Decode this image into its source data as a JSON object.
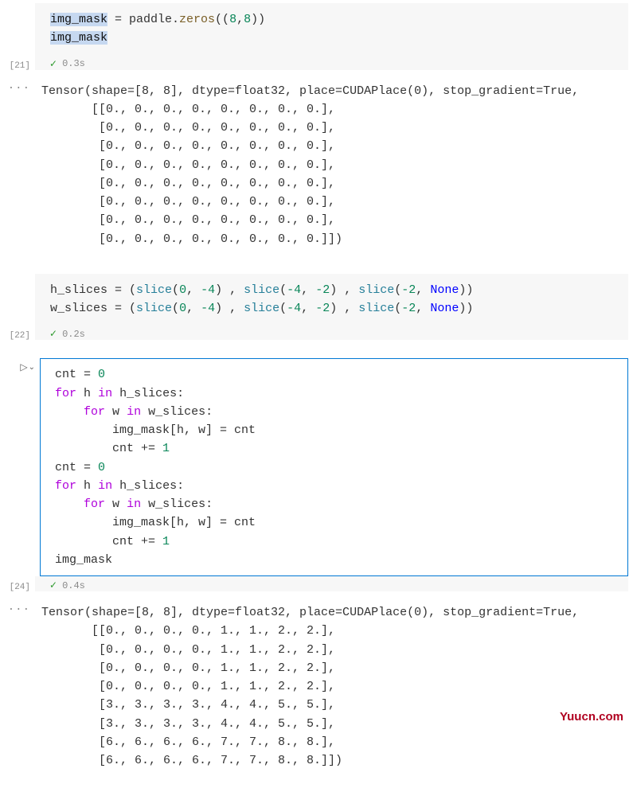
{
  "watermark": "Yuucn.com",
  "cells": {
    "c21": {
      "number": "[21]",
      "time": "0.3s",
      "code": {
        "l1_sel": "img_mask",
        "l1_rest": " = paddle.",
        "l1_fn": "zeros",
        "l1_args": "((",
        "l1_n1": "8",
        "l1_comma": ",",
        "l1_n2": "8",
        "l1_end": "))",
        "l2_sel": "img_mask"
      }
    },
    "out21": {
      "dots": "···",
      "text": "Tensor(shape=[8, 8], dtype=float32, place=CUDAPlace(0), stop_gradient=True,\n       [[0., 0., 0., 0., 0., 0., 0., 0.],\n        [0., 0., 0., 0., 0., 0., 0., 0.],\n        [0., 0., 0., 0., 0., 0., 0., 0.],\n        [0., 0., 0., 0., 0., 0., 0., 0.],\n        [0., 0., 0., 0., 0., 0., 0., 0.],\n        [0., 0., 0., 0., 0., 0., 0., 0.],\n        [0., 0., 0., 0., 0., 0., 0., 0.],\n        [0., 0., 0., 0., 0., 0., 0., 0.]])"
    },
    "c22": {
      "number": "[22]",
      "time": "0.2s",
      "code": {
        "seg_h": "h_slices = (",
        "seg_w": "w_slices = (",
        "slice_fn": "slice",
        "none_kw": "None",
        "n0": "0",
        "nm4": "-4",
        "nm2": "-2",
        "sep": " , ",
        "close": "))"
      }
    },
    "c24": {
      "number": "[24]",
      "time": "0.4s",
      "code": {
        "cnt0": "cnt = ",
        "zero": "0",
        "for_kw": "for",
        "in_kw": "in",
        "h_ident": "h",
        "w_ident": "w",
        "hs_ident": "h_slices",
        "ws_ident": "w_slices",
        "colon": ":",
        "assign": "img_mask[h, w] = cnt",
        "inc": "cnt += ",
        "one": "1",
        "final": "img_mask"
      }
    },
    "out24": {
      "dots": "···",
      "text": "Tensor(shape=[8, 8], dtype=float32, place=CUDAPlace(0), stop_gradient=True,\n       [[0., 0., 0., 0., 1., 1., 2., 2.],\n        [0., 0., 0., 0., 1., 1., 2., 2.],\n        [0., 0., 0., 0., 1., 1., 2., 2.],\n        [0., 0., 0., 0., 1., 1., 2., 2.],\n        [3., 3., 3., 3., 4., 4., 5., 5.],\n        [3., 3., 3., 3., 4., 4., 5., 5.],\n        [6., 6., 6., 6., 7., 7., 8., 8.],\n        [6., 6., 6., 6., 7., 7., 8., 8.]])"
    }
  }
}
